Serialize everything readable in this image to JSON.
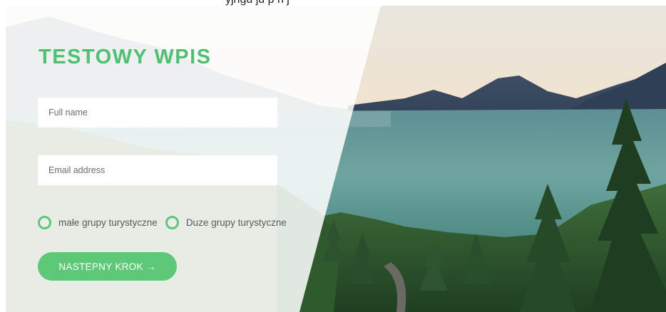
{
  "header": {
    "partial_text": "yjngu ju p  n  j"
  },
  "form": {
    "title": "TESTOWY WPIS",
    "full_name_placeholder": "Full name",
    "email_placeholder": "Email address",
    "radio_options": [
      {
        "label": "małe grupy turystyczne"
      },
      {
        "label": "Duze grupy turystyczne"
      }
    ],
    "next_button_label": "NASTEPNY KROK →"
  },
  "colors": {
    "accent_green": "#5cc77a",
    "title_green": "#4fbf72",
    "button_green": "#5dc878"
  },
  "icons": {
    "radio": "circle-outline",
    "arrow": "arrow-right"
  }
}
